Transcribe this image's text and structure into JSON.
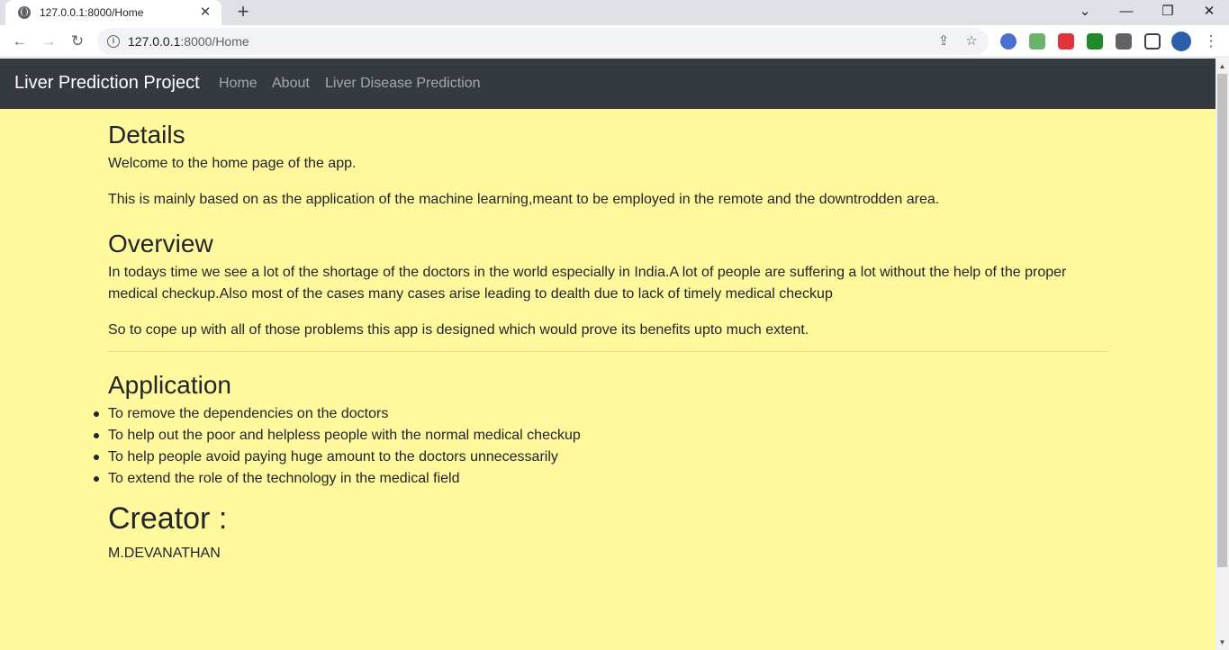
{
  "browser": {
    "tab_title": "127.0.0.1:8000/Home",
    "url_host": "127.0.0.1",
    "url_path": ":8000/Home"
  },
  "navbar": {
    "brand": "Liver Prediction Project",
    "links": [
      "Home",
      "About",
      "Liver Disease Prediction"
    ]
  },
  "details": {
    "heading": "Details",
    "paragraphs": [
      "Welcome to the home page of the app.",
      "This is mainly based on as the application of the machine learning,meant to be employed in the remote and the downtrodden area."
    ]
  },
  "overview": {
    "heading": "Overview",
    "paragraphs": [
      "In todays time we see a lot of the shortage of the doctors in the world especially in India.A lot of people are suffering a lot without the help of the proper medical checkup.Also most of the cases many cases arise leading to dealth due to lack of timely medical checkup",
      "So to cope up with all of those problems this app is designed which would prove its benefits upto much extent."
    ]
  },
  "application": {
    "heading": "Application",
    "items": [
      "To remove the dependencies on the doctors",
      "To help out the poor and helpless people with the normal medical checkup",
      "To help people avoid paying huge amount to the doctors unnecessarily",
      "To extend the role of the technology in the medical field"
    ]
  },
  "creator": {
    "heading": "Creator :",
    "name": "M.DEVANATHAN"
  },
  "colors": {
    "page_background": "#fff89d",
    "navbar_background": "#343a40"
  }
}
